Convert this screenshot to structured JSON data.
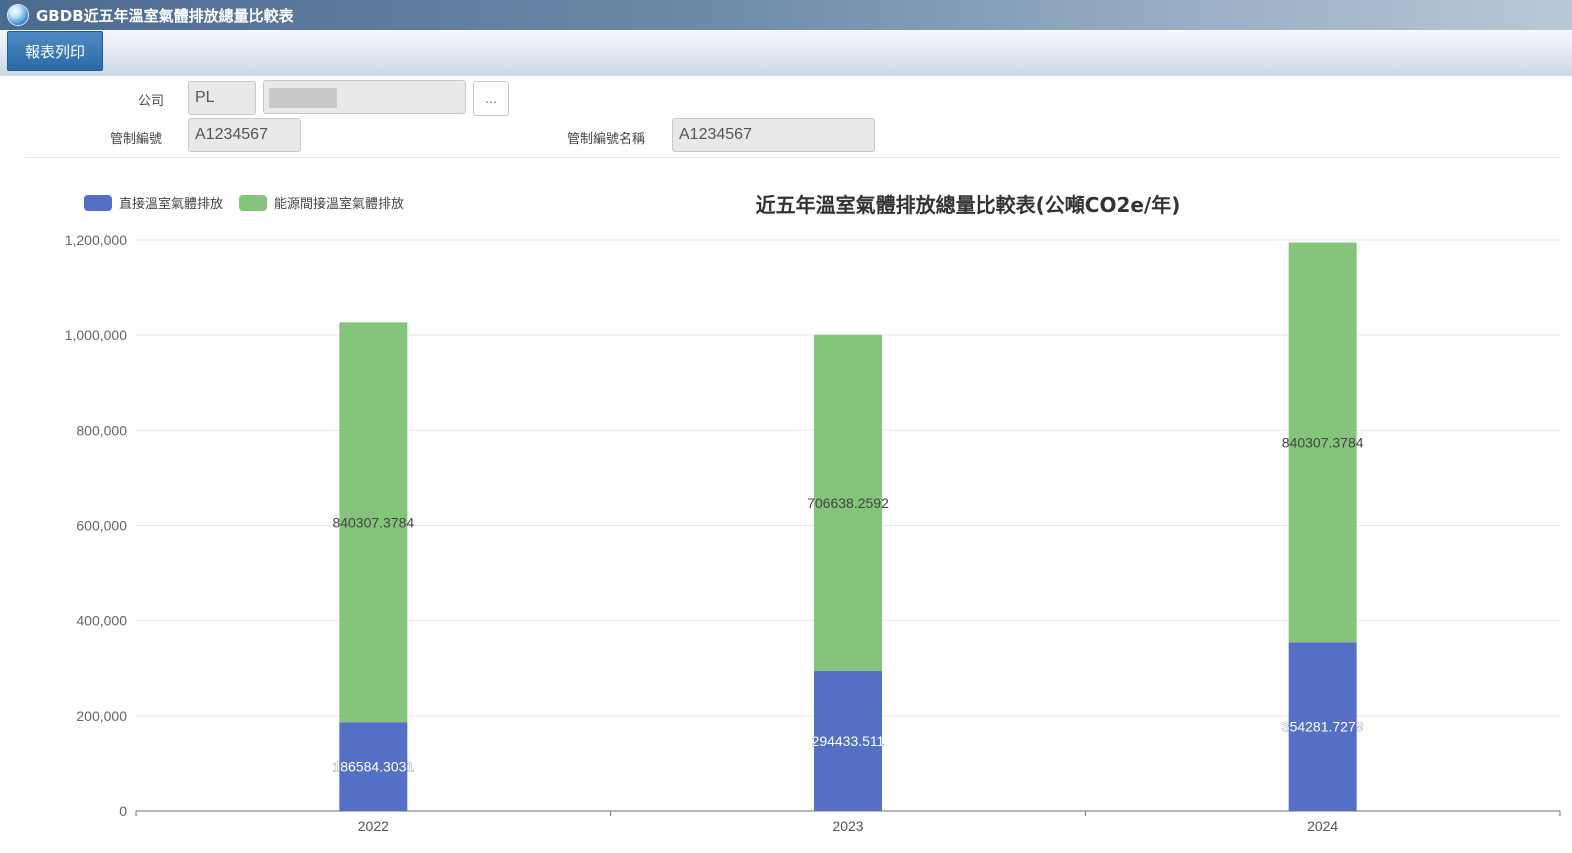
{
  "window": {
    "title": "GBDB近五年溫室氣體排放總量比較表"
  },
  "toolbar": {
    "print_label": "報表列印"
  },
  "form": {
    "company_label": "公司",
    "company_code": "PL",
    "company_name": "",
    "lookup_label": "...",
    "control_no_label": "管制編號",
    "control_no_value": "A1234567",
    "control_name_label": "管制編號名稱",
    "control_name_value": "A1234567"
  },
  "colors": {
    "direct": "#5470c6",
    "indirect": "#84c47b"
  },
  "chart_data": {
    "type": "bar",
    "stacked": true,
    "title": "近五年溫室氣體排放總量比較表(公噸CO2e/年)",
    "categories": [
      "2022",
      "2023",
      "2024"
    ],
    "series": [
      {
        "name": "直接溫室氣體排放",
        "values": [
          186584.3031,
          294433.511,
          354281.7279
        ],
        "labels": [
          "186584.3031",
          "294433.511",
          "354281.7279"
        ]
      },
      {
        "name": "能源間接溫室氣體排放",
        "values": [
          840307.3784,
          706638.2592,
          840307.3784
        ],
        "labels": [
          "840307.3784",
          "706638.2592",
          "840307.3784"
        ]
      }
    ],
    "ylim": [
      0,
      1200000
    ],
    "yticks": [
      0,
      200000,
      400000,
      600000,
      800000,
      1000000,
      1200000
    ],
    "ytick_labels": [
      "0",
      "200,000",
      "400,000",
      "600,000",
      "800,000",
      "1,000,000",
      "1,200,000"
    ],
    "grid": true,
    "legend_position": "top-left"
  }
}
